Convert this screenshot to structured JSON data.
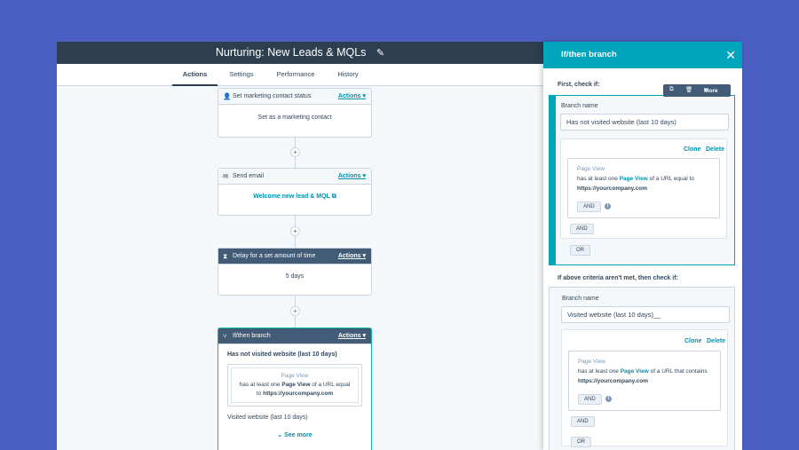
{
  "header": {
    "title": "Nurturing: New Leads & MQLs"
  },
  "tabs": [
    {
      "label": "Actions"
    },
    {
      "label": "Settings"
    },
    {
      "label": "Performance"
    },
    {
      "label": "History"
    }
  ],
  "workflow": {
    "actions_label": "Actions",
    "steps": [
      {
        "title": "Set marketing contact status",
        "body": "Set as a marketing contact"
      },
      {
        "title": "Send email",
        "body": "Welcome new lead & MQL"
      },
      {
        "title": "Delay for a set amount of time",
        "body": "5 days"
      },
      {
        "title": "If/then branch"
      }
    ],
    "branch": {
      "name": "Has not visited website (last 10 days)",
      "criteria_type": "Page View",
      "criteria_pre": "has at least one",
      "criteria_link": "Page View",
      "criteria_mid": "of a URL equal to",
      "criteria_url": "https://yourcompany.com",
      "second_name": "Visited website (last 10 days)",
      "see_more": "See more"
    }
  },
  "panel": {
    "title": "If/then branch",
    "first_check": "First, check if:",
    "toolbar_more": "More",
    "branch_name_label": "Branch name",
    "clone_label": "Clone",
    "delete_label": "Delete",
    "and_label": "AND",
    "or_label": "OR",
    "branch1": {
      "name": "Has not visited website (last 10 days)",
      "criteria_type": "Page View",
      "criteria_pre": "has at least one",
      "criteria_link": "Page View",
      "criteria_mid": "of a URL equal to",
      "criteria_url": "https://yourcompany.com"
    },
    "else_check": "If above criteria aren't met, then check if:",
    "branch2": {
      "name": "Visited website (last 10 days)__",
      "criteria_type": "Page View",
      "criteria_pre": "has at least one",
      "criteria_link": "Page View",
      "criteria_mid": "of a URL that contains",
      "criteria_url": "https://yourcompany.com"
    }
  },
  "colors": {
    "header": "#2d3e50",
    "accent": "#00a4bd",
    "background": "#4a5fc1"
  }
}
